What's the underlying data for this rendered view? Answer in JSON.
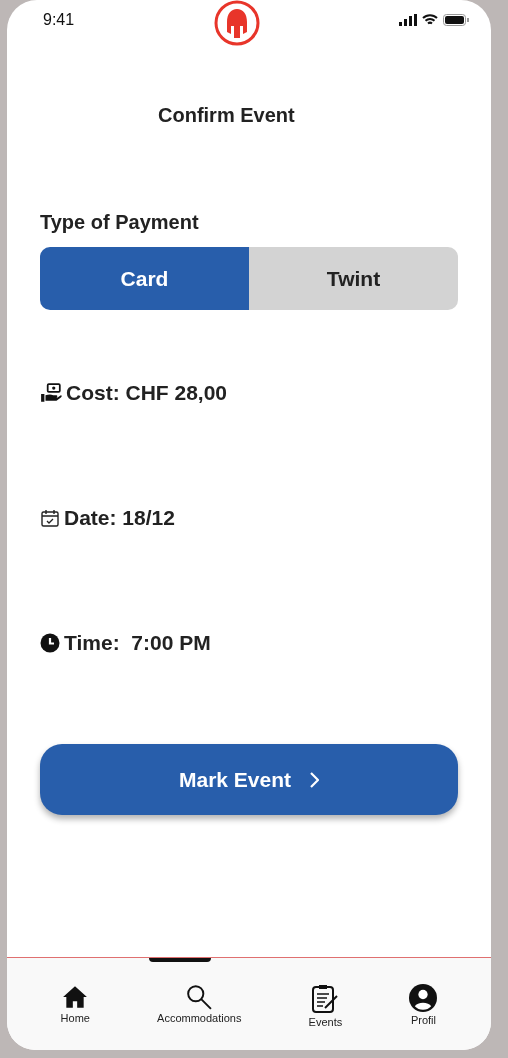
{
  "status_bar": {
    "time": "9:41"
  },
  "title": "Confirm Event",
  "payment": {
    "label": "Type of Payment",
    "options": [
      {
        "label": "Card",
        "selected": true
      },
      {
        "label": "Twint",
        "selected": false
      }
    ]
  },
  "details": [
    {
      "kind": "cost",
      "text": "Cost: CHF 28,00"
    },
    {
      "kind": "date",
      "text": "Date: 18/12"
    },
    {
      "kind": "time",
      "text": "Time:  7:00 PM"
    }
  ],
  "action": {
    "label": "Mark Event"
  },
  "nav": [
    {
      "kind": "home",
      "label": "Home"
    },
    {
      "kind": "search",
      "label": "Accommodations"
    },
    {
      "kind": "events",
      "label": "Events"
    },
    {
      "kind": "profile",
      "label": "Profil"
    }
  ]
}
